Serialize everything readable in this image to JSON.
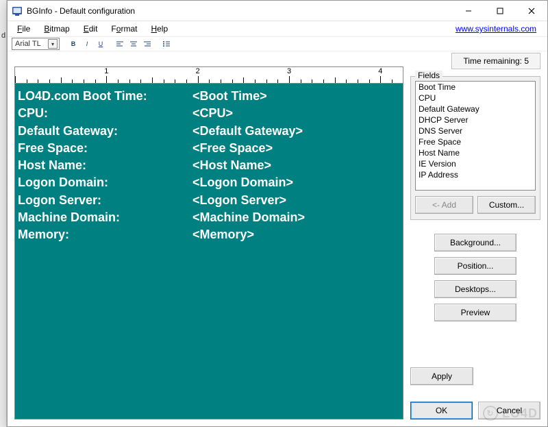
{
  "window": {
    "title": "BGInfo - Default configuration"
  },
  "menubar": {
    "file": "File",
    "bitmap": "Bitmap",
    "edit": "Edit",
    "format": "Format",
    "help": "Help",
    "link_text": "www.sysinternals.com"
  },
  "toolbar": {
    "font_name_partial": "Arial TL",
    "bold": "B",
    "italic": "I",
    "underline": "U"
  },
  "timer": {
    "label": "Time remaining: 5"
  },
  "ruler": {
    "numbers": [
      "1",
      "2",
      "3",
      "4"
    ]
  },
  "editor": {
    "rows": [
      {
        "label": "LO4D.com Boot Time:",
        "value": "<Boot Time>"
      },
      {
        "label": "CPU:",
        "value": "<CPU>"
      },
      {
        "label": "Default Gateway:",
        "value": "<Default Gateway>"
      },
      {
        "label": "Free Space:",
        "value": "<Free Space>"
      },
      {
        "label": "Host Name:",
        "value": "<Host Name>"
      },
      {
        "label": "Logon Domain:",
        "value": "<Logon Domain>"
      },
      {
        "label": "Logon Server:",
        "value": "<Logon Server>"
      },
      {
        "label": "Machine Domain:",
        "value": "<Machine Domain>"
      },
      {
        "label": "Memory:",
        "value": "<Memory>"
      }
    ]
  },
  "fields": {
    "legend": "Fields",
    "items": [
      "Boot Time",
      "CPU",
      "Default Gateway",
      "DHCP Server",
      "DNS Server",
      "Free Space",
      "Host Name",
      "IE Version",
      "IP Address"
    ],
    "add_label": "<- Add",
    "custom_label": "Custom..."
  },
  "side_buttons": {
    "background": "Background...",
    "position": "Position...",
    "desktops": "Desktops...",
    "preview": "Preview"
  },
  "bottom_buttons": {
    "apply": "Apply",
    "ok": "OK",
    "cancel": "Cancel"
  },
  "watermark": "LO4D"
}
